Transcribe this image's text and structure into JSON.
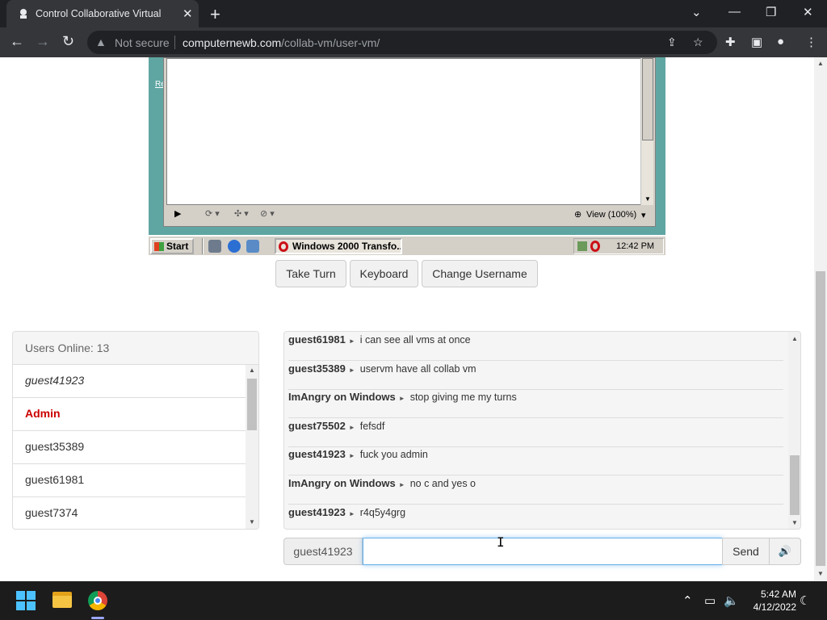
{
  "browser": {
    "tab_title": "Control Collaborative Virtual",
    "not_secure": "Not secure",
    "url_domain": "computernewb.com",
    "url_path": "/collab-vm/user-vm/"
  },
  "vm": {
    "side_link": "Re",
    "status_view": "View (100%)",
    "start_label": "Start",
    "task_item": "Windows 2000 Transfo...",
    "tray_time": "12:42 PM"
  },
  "controls": {
    "take_turn": "Take Turn",
    "keyboard": "Keyboard",
    "change_username": "Change Username"
  },
  "users": {
    "header": "Users Online: 13",
    "list": [
      {
        "name": "guest41923",
        "style": "italic"
      },
      {
        "name": "Admin",
        "style": "admin"
      },
      {
        "name": "guest35389",
        "style": "normal"
      },
      {
        "name": "guest61981",
        "style": "normal"
      },
      {
        "name": "guest7374",
        "style": "normal"
      }
    ]
  },
  "chat": {
    "messages": [
      {
        "user": "guest61981",
        "text": "i can see all vms at once"
      },
      {
        "user": "guest35389",
        "text": "uservm have all collab vm"
      },
      {
        "user": "ImAngry on Windows",
        "text": "stop giving me my turns"
      },
      {
        "user": "guest75502",
        "text": "fefsdf"
      },
      {
        "user": "guest41923",
        "text": "fuck you admin"
      },
      {
        "user": "ImAngry on Windows",
        "text": "no c and yes o"
      },
      {
        "user": "guest41923",
        "text": "r4q5y4grg"
      }
    ],
    "username": "guest41923",
    "input_value": "",
    "send_label": "Send"
  },
  "taskbar": {
    "time": "5:42 AM",
    "date": "4/12/2022"
  },
  "colors": {
    "accent": "#66afe9",
    "admin": "#cc0000",
    "vm_desktop": "#5fa6a3"
  }
}
